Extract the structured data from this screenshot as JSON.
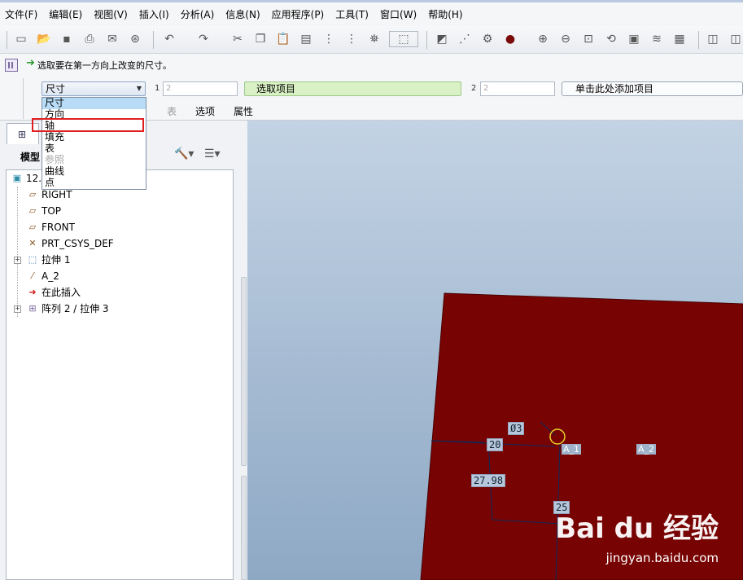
{
  "menu": [
    "文件(F)",
    "编辑(E)",
    "视图(V)",
    "插入(I)",
    "分析(A)",
    "信息(N)",
    "应用程序(P)",
    "工具(T)",
    "窗口(W)",
    "帮助(H)"
  ],
  "toolbar_icons": [
    "new-icon",
    "open-icon",
    "save-icon",
    "print-icon",
    "send-icon",
    "link-icon",
    "undo-icon",
    "redo-icon",
    "cut-icon",
    "copy-icon",
    "paste-icon",
    "paste-special-icon",
    "regenerate-icon",
    "regen-manager-icon",
    "find-icon",
    "select-box-icon",
    "orient-icon",
    "datum-point-icon",
    "csys-icon",
    "shading-icon",
    "zoom-in-icon",
    "zoom-out-icon",
    "refit-icon",
    "spin-icon",
    "annotation-icon",
    "layers-icon",
    "view-manager-icon",
    "display-style-icon"
  ],
  "dashboard": {
    "message": "选取要在第一方向上改变的尺寸。",
    "type_select": "尺寸",
    "num1": "1",
    "input1": "2",
    "collector1": "选取项目",
    "num2": "2",
    "input2": "2",
    "collector2": "单击此处添加项目",
    "tabs": [
      "表",
      "选项",
      "属性"
    ]
  },
  "dropdown_options": [
    {
      "label": "尺寸",
      "state": "selected"
    },
    {
      "label": "方向",
      "state": "normal"
    },
    {
      "label": "轴",
      "state": "highlighted"
    },
    {
      "label": "填充",
      "state": "normal"
    },
    {
      "label": "表",
      "state": "normal"
    },
    {
      "label": "参照",
      "state": "disabled"
    },
    {
      "label": "曲线",
      "state": "normal"
    },
    {
      "label": "点",
      "state": "normal"
    }
  ],
  "model_tree": {
    "title": "模型",
    "items": [
      {
        "label": "12.P",
        "icon": "part-icon",
        "expander": false
      },
      {
        "label": "RIGHT",
        "icon": "datum-plane-icon",
        "expander": false
      },
      {
        "label": "TOP",
        "icon": "datum-plane-icon",
        "expander": false
      },
      {
        "label": "FRONT",
        "icon": "datum-plane-icon",
        "expander": false
      },
      {
        "label": "PRT_CSYS_DEF",
        "icon": "csys-icon",
        "expander": false
      },
      {
        "label": "拉伸 1",
        "icon": "extrude-icon",
        "expander": true
      },
      {
        "label": "A_2",
        "icon": "datum-axis-icon",
        "expander": false
      },
      {
        "label": "在此插入",
        "icon": "insert-here-icon",
        "expander": false
      },
      {
        "label": "阵列 2 / 拉伸 3",
        "icon": "pattern-icon",
        "expander": true
      }
    ]
  },
  "viewport": {
    "dimensions": [
      "Ø3",
      "20",
      "27.98",
      "25"
    ],
    "axis_labels": [
      "A_1",
      "A_2"
    ],
    "part_color": "#780303"
  },
  "watermark": {
    "brand": "Bai du 经验",
    "url": "jingyan.baidu.com"
  }
}
